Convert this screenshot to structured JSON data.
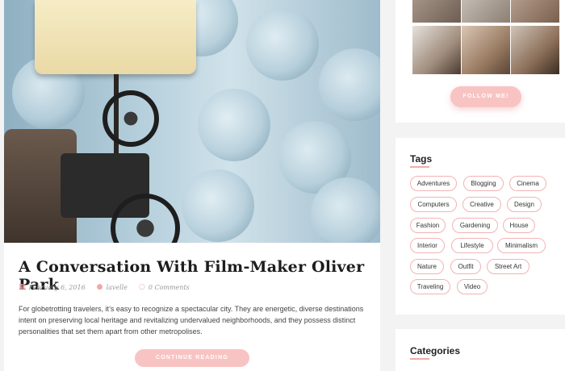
{
  "post": {
    "title": "A Conversation With Film-Maker Oliver Park",
    "date": "February 6, 2016",
    "author": "lavelle",
    "comments": "0 Comments",
    "excerpt": "For globetrotting travelers, it’s easy to recognize a spectacular city. They are energetic, diverse destinations intent on preserving local heritage and revitalizing undervalued neighborhoods, and they possess distinct personalities that set them apart from other metropolises.",
    "continue_label": "CONTINUE READING"
  },
  "sidebar": {
    "follow_label": "FOLLOW ME!",
    "tags_title": "Tags",
    "tags": [
      "Adventures",
      "Blogging",
      "Cinema",
      "Computers",
      "Creative",
      "Design",
      "Fashion",
      "Gardening",
      "House",
      "Interior",
      "Lifestyle",
      "Minimalism",
      "Nature",
      "Outfit",
      "Street Art",
      "Traveling",
      "Video"
    ],
    "categories_title": "Categories"
  },
  "icons": {
    "date": "calendar-icon",
    "author": "user-icon",
    "comments": "comment-icon"
  },
  "colors": {
    "accent": "#f8c4c3",
    "tag_border": "#f3b3b4",
    "underline": "#f4a9a8"
  }
}
